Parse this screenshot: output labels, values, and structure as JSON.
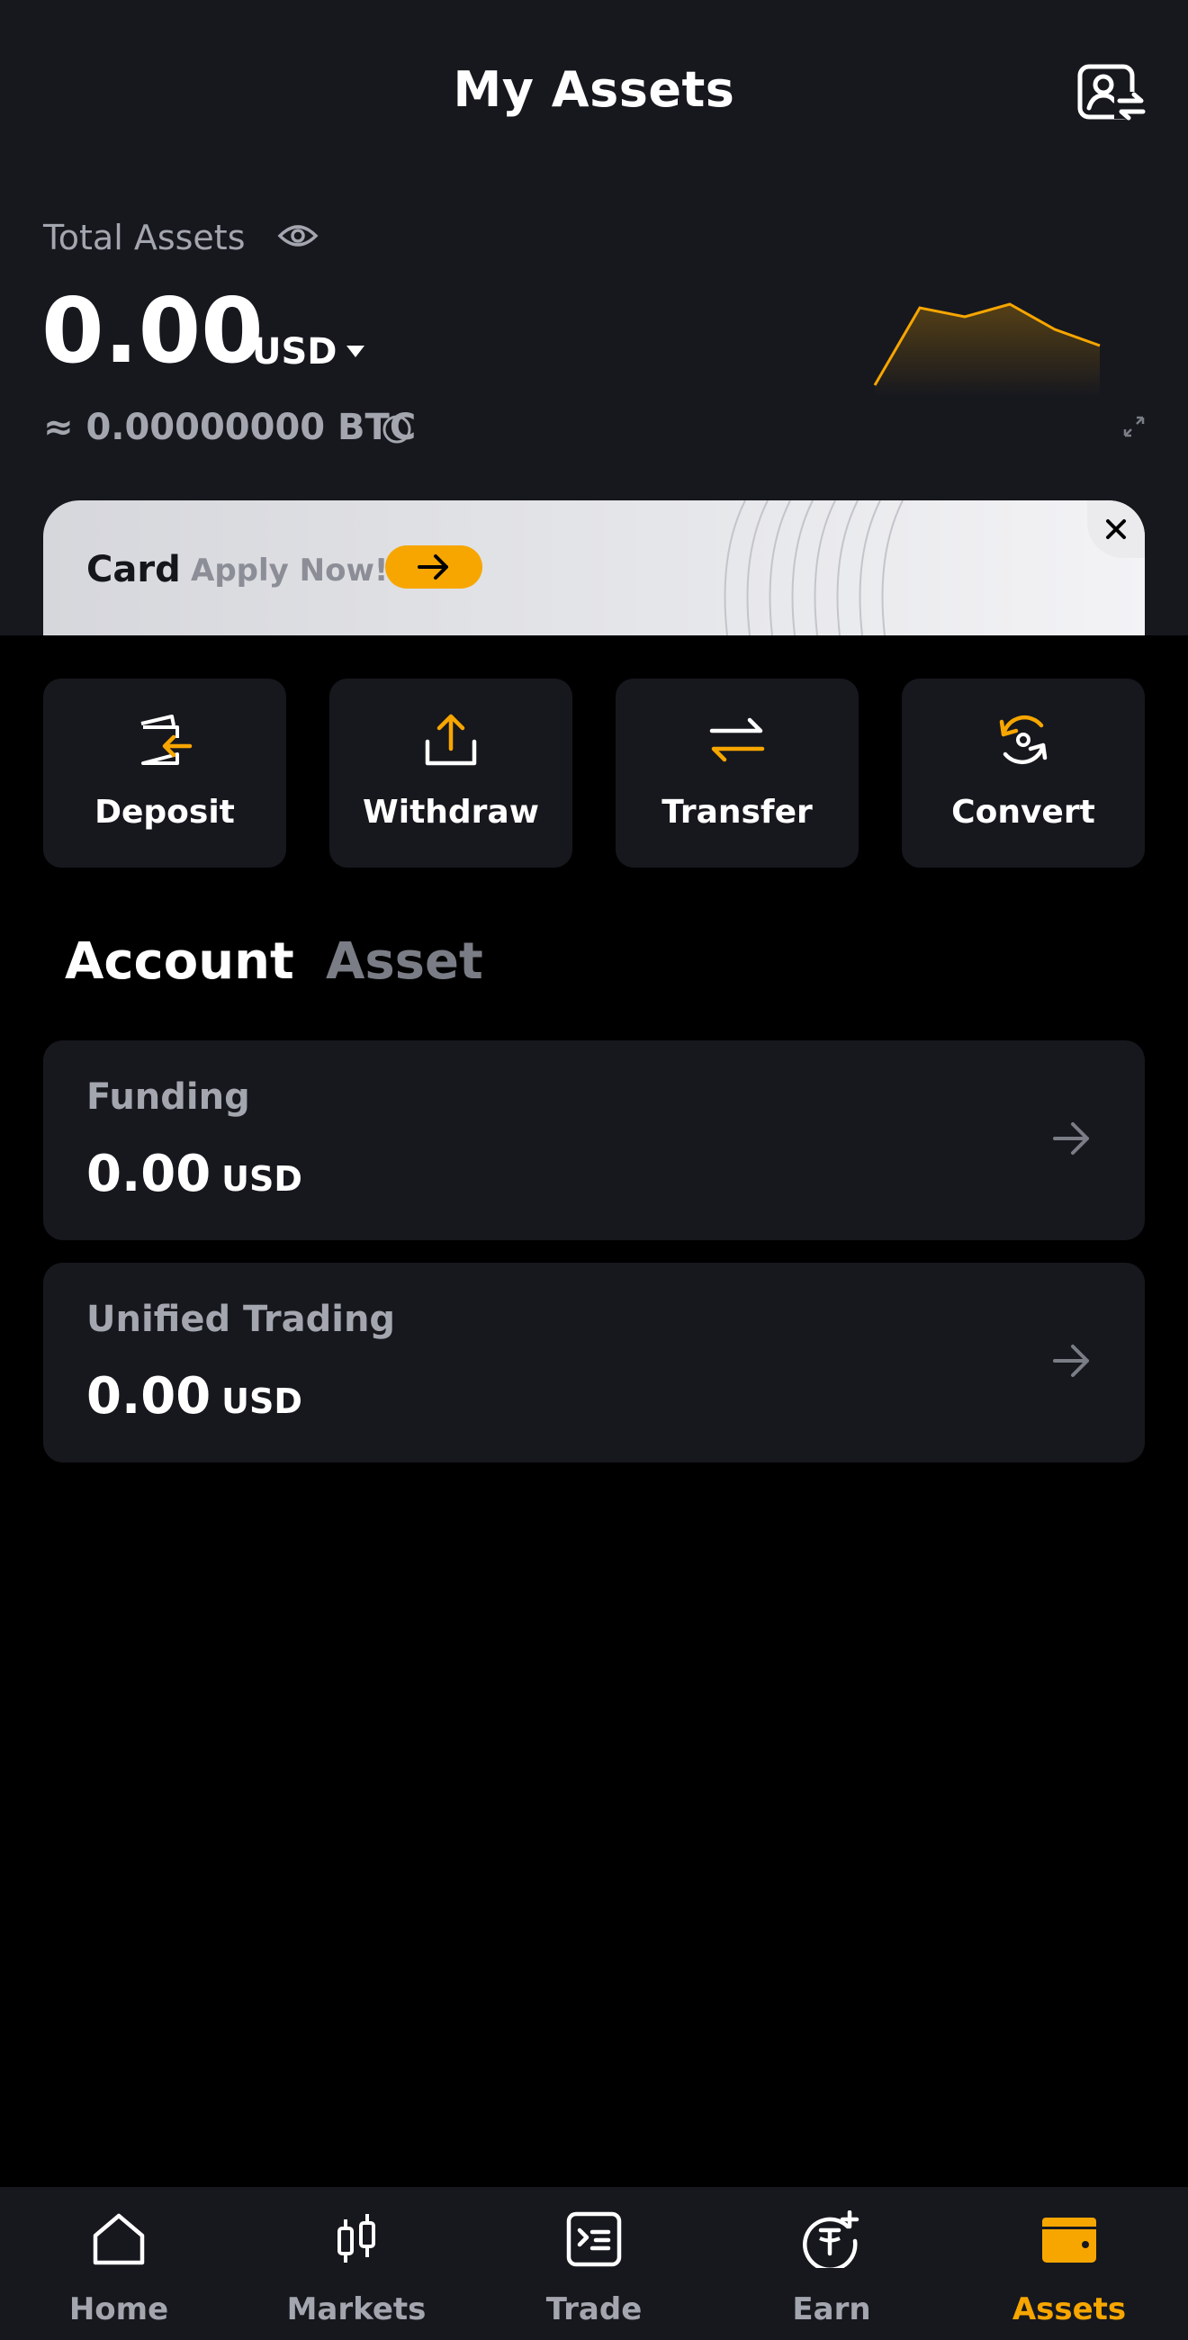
{
  "header": {
    "title": "My Assets",
    "profile_icon": "profile-switch-icon"
  },
  "total_assets": {
    "label": "Total Assets",
    "value": "0.00",
    "currency": "USD",
    "btc_equivalent": "≈ 0.00000000 BTC",
    "sparkline_color": "#f7a600"
  },
  "card_banner": {
    "label": "Card",
    "cta": "Apply Now!",
    "accent": "#f7a600"
  },
  "actions": [
    {
      "label": "Deposit",
      "icon": "deposit-icon"
    },
    {
      "label": "Withdraw",
      "icon": "withdraw-icon"
    },
    {
      "label": "Transfer",
      "icon": "transfer-icon"
    },
    {
      "label": "Convert",
      "icon": "convert-icon"
    }
  ],
  "tabs": [
    {
      "label": "Account",
      "active": true
    },
    {
      "label": "Asset",
      "active": false
    }
  ],
  "accounts": [
    {
      "name": "Funding",
      "value": "0.00",
      "currency": "USD"
    },
    {
      "name": "Unified Trading",
      "value": "0.00",
      "currency": "USD"
    }
  ],
  "bottom_nav": [
    {
      "label": "Home",
      "icon": "home-icon",
      "active": false
    },
    {
      "label": "Markets",
      "icon": "markets-icon",
      "active": false
    },
    {
      "label": "Trade",
      "icon": "trade-icon",
      "active": false
    },
    {
      "label": "Earn",
      "icon": "earn-icon",
      "active": false
    },
    {
      "label": "Assets",
      "icon": "wallet-icon",
      "active": true
    }
  ],
  "colors": {
    "accent": "#f7a600",
    "background": "#000000",
    "surface": "#17181e",
    "muted_text": "#a3a6ae"
  }
}
